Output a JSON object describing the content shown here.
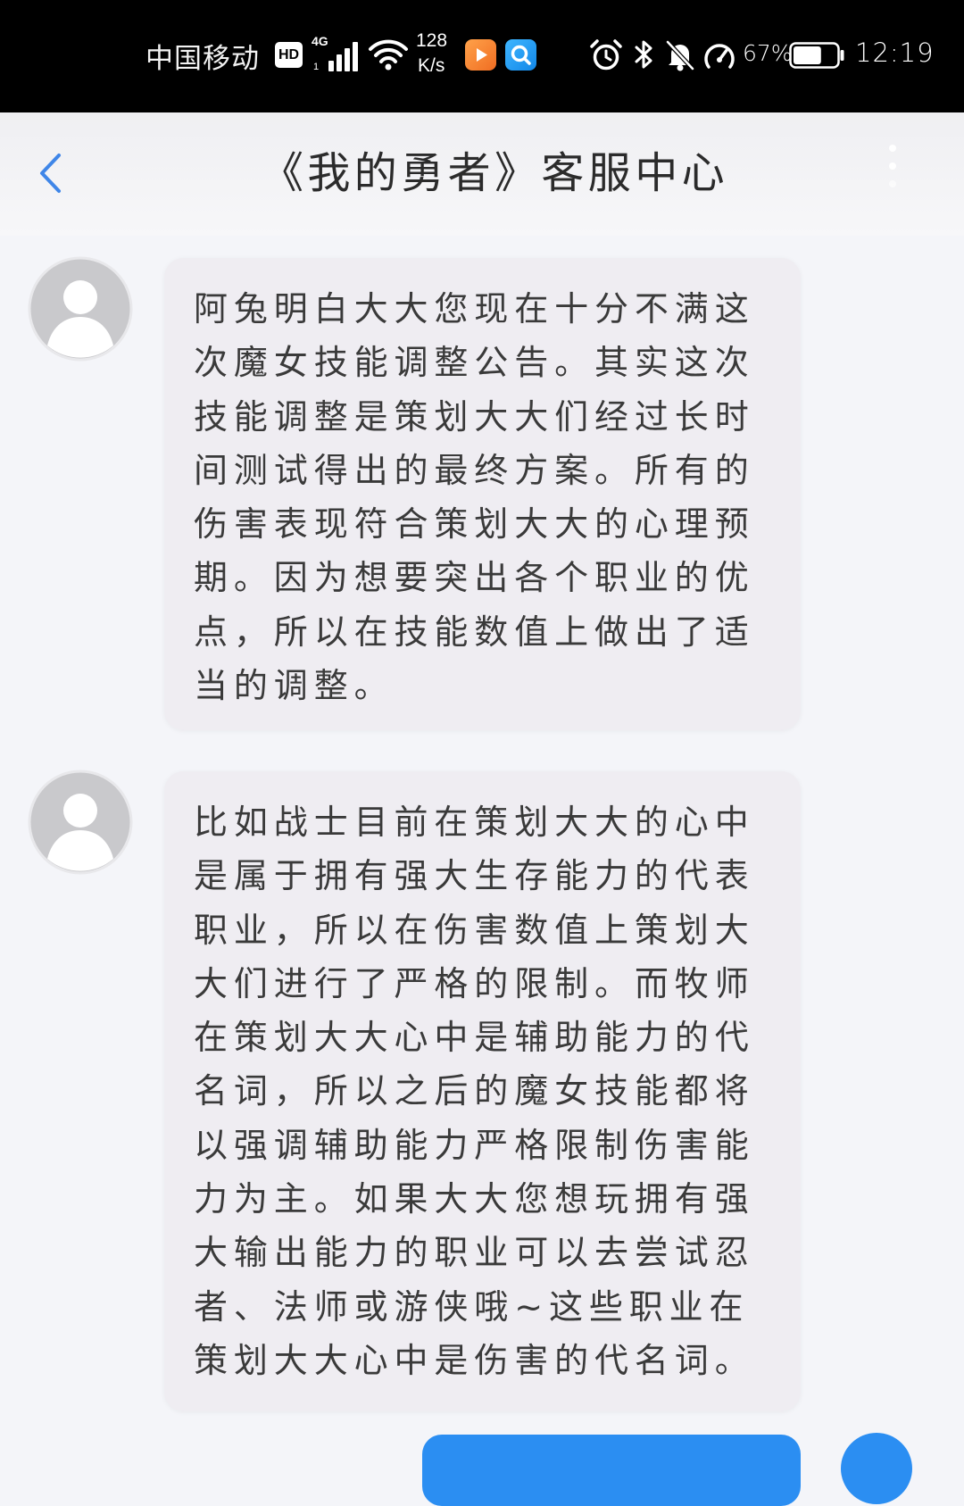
{
  "status_bar": {
    "carrier": "中国移动",
    "hd_badge": "HD",
    "network_type": "4G",
    "net_speed_value": "128",
    "net_speed_unit": "K/s",
    "battery_text": "67%",
    "battery_level": 0.67,
    "time": "12:19",
    "icons": [
      "hd-icon",
      "signal-icon",
      "wifi-icon",
      "video-app-icon",
      "search-app-icon",
      "alarm-icon",
      "bluetooth-icon",
      "mute-bell-icon",
      "speed-icon",
      "battery-icon"
    ]
  },
  "header": {
    "title": "《我的勇者》客服中心",
    "back_icon": "chevron-left-icon",
    "more_icon": "more-vertical-icon"
  },
  "messages": [
    {
      "avatar_icon": "default-avatar-icon",
      "lines": [
        "阿兔明白大大您现在十分不满这",
        "次魔女技能调整公告。其实这次",
        "技能调整是策划大大们经过长时",
        "间测试得出的最终方案。所有的",
        "伤害表现符合策划大大的心理预",
        "期。因为想要突出各个职业的优",
        "点，所以在技能数值上做出了适",
        "当的调整。"
      ]
    },
    {
      "avatar_icon": "default-avatar-icon",
      "lines": [
        "比如战士目前在策划大大的心中",
        "是属于拥有强大生存能力的代表",
        "职业，所以在伤害数值上策划大",
        "大们进行了严格的限制。而牧师",
        "在策划大大心中是辅助能力的代",
        "名词，所以之后的魔女技能都将",
        "以强调辅助能力严格限制伤害能",
        "力为主。如果大大您想玩拥有强",
        "大输出能力的职业可以去尝试忍",
        "者、法师或游侠哦~这些职业在",
        "策划大大心中是伤害的代名词。"
      ]
    }
  ],
  "colors": {
    "status_bar_bg": "#000000",
    "accent_blue": "#3f86e8",
    "page_bg": "#f4f5f9",
    "bubble_bg": "#efedf2",
    "text": "#3a3a3a",
    "user_bubble": "#2b8ef2"
  }
}
